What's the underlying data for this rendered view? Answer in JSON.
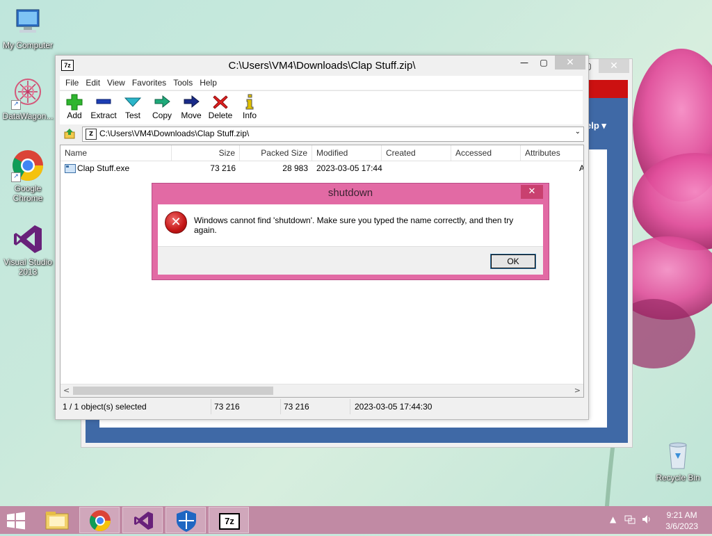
{
  "desktop": {
    "icons": [
      {
        "label": "My Computer",
        "icon": "computer-icon"
      },
      {
        "label": "DataWagon...",
        "icon": "datawagon-icon"
      },
      {
        "label": "Google Chrome",
        "icon": "chrome-icon"
      },
      {
        "label": "Visual Studio 2013",
        "icon": "visual-studio-icon"
      },
      {
        "label": "Recycle Bin",
        "icon": "recycle-bin-icon"
      }
    ]
  },
  "background_window": {
    "help_label": "elp ▾",
    "close_glyph": "✕"
  },
  "sevenzip": {
    "app_icon_text": "7z",
    "title": "C:\\Users\\VM4\\Downloads\\Clap Stuff.zip\\",
    "controls": {
      "minimize": "—",
      "maximize": "▢",
      "close": "✕"
    },
    "menu": [
      "File",
      "Edit",
      "View",
      "Favorites",
      "Tools",
      "Help"
    ],
    "toolbar": [
      {
        "label": "Add",
        "icon": "plus-icon"
      },
      {
        "label": "Extract",
        "icon": "minus-icon"
      },
      {
        "label": "Test",
        "icon": "check-icon"
      },
      {
        "label": "Copy",
        "icon": "copy-arrow-icon"
      },
      {
        "label": "Move",
        "icon": "move-arrow-icon"
      },
      {
        "label": "Delete",
        "icon": "delete-x-icon"
      },
      {
        "label": "Info",
        "icon": "info-icon"
      }
    ],
    "address": "C:\\Users\\VM4\\Downloads\\Clap Stuff.zip\\",
    "columns": [
      "Name",
      "Size",
      "Packed Size",
      "Modified",
      "Created",
      "Accessed",
      "Attributes"
    ],
    "rows": [
      {
        "name": "Clap Stuff.exe",
        "size": "73 216",
        "packed": "28 983",
        "modified": "2023-03-05 17:44",
        "created": "",
        "accessed": "",
        "attributes": "A"
      }
    ],
    "status": {
      "selection": "1 / 1 object(s) selected",
      "size": "73 216",
      "packed": "73 216",
      "modified": "2023-03-05 17:44:30"
    }
  },
  "dialog": {
    "title": "shutdown",
    "message": "Windows cannot find 'shutdown'. Make sure you typed the name correctly, and then try again.",
    "ok_label": "OK",
    "close_glyph": "✕",
    "error_glyph": "✕"
  },
  "taskbar": {
    "pinned": [
      "file-explorer-icon",
      "chrome-icon",
      "visual-studio-icon",
      "security-shield-icon",
      "7zip-icon"
    ],
    "sevenzip_text": "7z",
    "tray_up": "▲",
    "time": "9:21 AM",
    "date": "3/6/2023"
  },
  "colors": {
    "dialog_frame": "#e26aa4",
    "taskbar": "#c18aa4",
    "accent_blue": "#3f69a6",
    "error_red": "#c41616"
  }
}
